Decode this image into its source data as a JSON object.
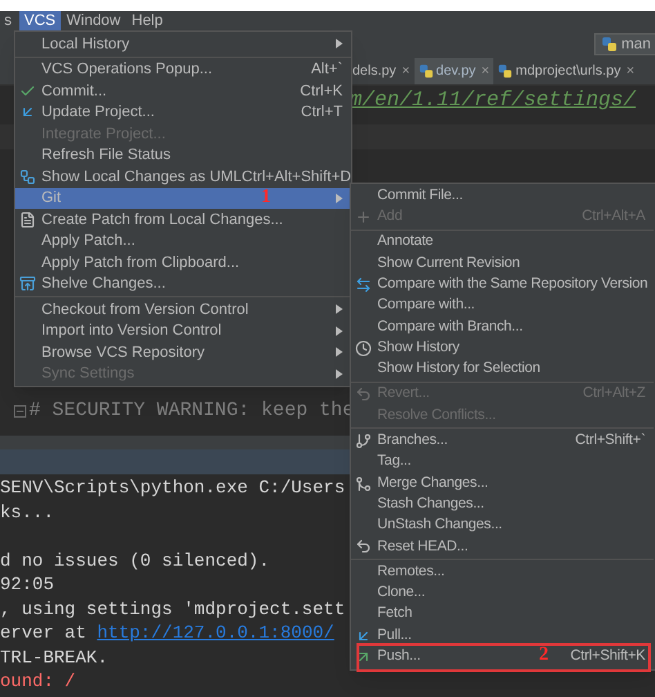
{
  "menubar": [
    {
      "label": "s",
      "selected": false
    },
    {
      "label": "VCS",
      "selected": true
    },
    {
      "label": "Window",
      "selected": false
    },
    {
      "label": "Help",
      "selected": false
    }
  ],
  "toolbar": {
    "run_config": "man"
  },
  "editor_tabs": [
    {
      "label": "dels.py",
      "close": "×",
      "selected": false
    },
    {
      "label": "dev.py",
      "close": "×",
      "selected": true
    },
    {
      "label": "mdproject\\urls.py",
      "close": "×",
      "selected": false
    }
  ],
  "editor": {
    "url_line": "m/en/1.11/ref/settings/",
    "comment_line": "# SECURITY WARNING: keep the"
  },
  "console": {
    "lines": [
      {
        "kind": "plain",
        "text": "SENV\\Scripts\\python.exe C:/Users"
      },
      {
        "kind": "plain",
        "text": "ks..."
      },
      {
        "kind": "blank"
      },
      {
        "kind": "plain",
        "text": "d no issues (0 silenced)."
      },
      {
        "kind": "plain",
        "text": "92:05"
      },
      {
        "kind": "plain",
        "text": ", using settings 'mdproject.sett"
      },
      {
        "kind": "link",
        "text": "erver at ",
        "link": "http://127.0.0.1:8000/"
      },
      {
        "kind": "plain",
        "text": "TRL-BREAK."
      },
      {
        "kind": "error",
        "text": "ound: /"
      }
    ]
  },
  "vcs_menu": {
    "groups": [
      {
        "items": [
          {
            "label": "Local History",
            "disabled": false,
            "selected": false,
            "has_submenu": true
          }
        ]
      },
      {
        "items": [
          {
            "label": "VCS Operations Popup...",
            "shortcut": "Alt+`",
            "disabled": false,
            "selected": false,
            "has_submenu": false
          },
          {
            "label": "Commit...",
            "shortcut": "Ctrl+K",
            "disabled": false,
            "selected": false,
            "has_submenu": false
          },
          {
            "label": "Update Project...",
            "shortcut": "Ctrl+T",
            "disabled": false,
            "selected": false,
            "has_submenu": false
          },
          {
            "label": "Integrate Project...",
            "disabled": true,
            "selected": false,
            "has_submenu": false
          },
          {
            "label": "Refresh File Status",
            "disabled": false,
            "selected": false,
            "has_submenu": false
          },
          {
            "label": "Show Local Changes as UML",
            "shortcut": "Ctrl+Alt+Shift+D",
            "disabled": false,
            "selected": false,
            "has_submenu": false
          },
          {
            "label": "Git",
            "disabled": false,
            "selected": true,
            "has_submenu": true,
            "annotation": "1"
          },
          {
            "label": "Create Patch from Local Changes...",
            "disabled": false,
            "selected": false,
            "has_submenu": false
          },
          {
            "label": "Apply Patch...",
            "disabled": false,
            "selected": false,
            "has_submenu": false
          },
          {
            "label": "Apply Patch from Clipboard...",
            "disabled": false,
            "selected": false,
            "has_submenu": false
          },
          {
            "label": "Shelve Changes...",
            "disabled": false,
            "selected": false,
            "has_submenu": false
          }
        ]
      },
      {
        "items": [
          {
            "label": "Checkout from Version Control",
            "disabled": false,
            "selected": false,
            "has_submenu": true
          },
          {
            "label": "Import into Version Control",
            "disabled": false,
            "selected": false,
            "has_submenu": true
          },
          {
            "label": "Browse VCS Repository",
            "disabled": false,
            "selected": false,
            "has_submenu": true
          },
          {
            "label": "Sync Settings",
            "disabled": true,
            "selected": false,
            "has_submenu": true
          }
        ]
      }
    ]
  },
  "git_submenu": {
    "groups": [
      {
        "items": [
          {
            "label": "Commit File...",
            "disabled": false,
            "selected": false
          },
          {
            "label": "Add",
            "shortcut": "Ctrl+Alt+A",
            "disabled": true,
            "selected": false
          }
        ]
      },
      {
        "items": [
          {
            "label": "Annotate",
            "disabled": false,
            "selected": false
          },
          {
            "label": "Show Current Revision",
            "disabled": false,
            "selected": false
          },
          {
            "label": "Compare with the Same Repository Version",
            "disabled": false,
            "selected": false
          },
          {
            "label": "Compare with...",
            "disabled": false,
            "selected": false
          },
          {
            "label": "Compare with Branch...",
            "disabled": false,
            "selected": false
          },
          {
            "label": "Show History",
            "disabled": false,
            "selected": false
          },
          {
            "label": "Show History for Selection",
            "disabled": false,
            "selected": false
          }
        ]
      },
      {
        "items": [
          {
            "label": "Revert...",
            "shortcut": "Ctrl+Alt+Z",
            "disabled": true,
            "selected": false
          },
          {
            "label": "Resolve Conflicts...",
            "disabled": true,
            "selected": false
          }
        ]
      },
      {
        "items": [
          {
            "label": "Branches...",
            "shortcut": "Ctrl+Shift+`",
            "disabled": false,
            "selected": false
          },
          {
            "label": "Tag...",
            "disabled": false,
            "selected": false
          },
          {
            "label": "Merge Changes...",
            "disabled": false,
            "selected": false
          },
          {
            "label": "Stash Changes...",
            "disabled": false,
            "selected": false
          },
          {
            "label": "UnStash Changes...",
            "disabled": false,
            "selected": false
          },
          {
            "label": "Reset HEAD...",
            "disabled": false,
            "selected": false
          }
        ]
      },
      {
        "items": [
          {
            "label": "Remotes...",
            "disabled": false,
            "selected": false
          },
          {
            "label": "Clone...",
            "disabled": false,
            "selected": false
          },
          {
            "label": "Fetch",
            "disabled": false,
            "selected": false
          },
          {
            "label": "Pull...",
            "disabled": false,
            "selected": false
          },
          {
            "label": "Push...",
            "shortcut": "Ctrl+Shift+K",
            "disabled": false,
            "selected": false,
            "highlighted": true,
            "annotation": "2"
          }
        ]
      }
    ]
  }
}
